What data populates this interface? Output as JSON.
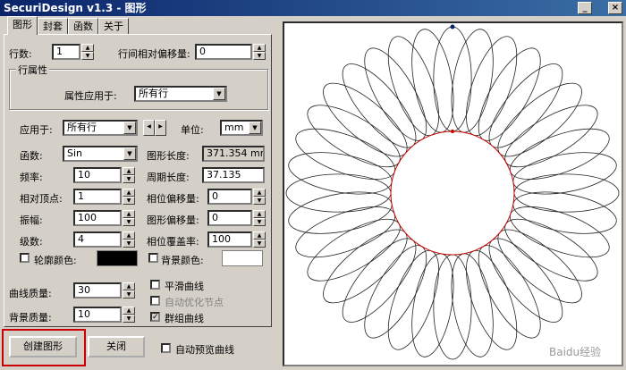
{
  "window": {
    "title": "SecuriDesign v1.3 - 图形",
    "minimize": "_",
    "close": "×"
  },
  "tabs": [
    "图形",
    "封套",
    "函数",
    "关于"
  ],
  "top_row": {
    "rows_label": "行数:",
    "rows_value": "1",
    "row_offset_label": "行间相对偏移量:",
    "row_offset_value": "0"
  },
  "row_props": {
    "group_title": "行属性",
    "apply_attr_label": "属性应用于:",
    "apply_attr_value": "所有行"
  },
  "fields": {
    "apply_label": "应用于:",
    "apply_value": "所有行",
    "unit_label": "单位:",
    "unit_value": "mm",
    "func_label": "函数:",
    "func_value": "Sin",
    "length_label": "图形长度:",
    "length_value": "371.354 mm",
    "freq_label": "频率:",
    "freq_value": "10",
    "period_label": "周期长度:",
    "period_value": "37.135",
    "vertex_label": "相对顶点:",
    "vertex_value": "1",
    "phase_offset_label": "相位偏移量:",
    "phase_offset_value": "0",
    "amp_label": "振幅:",
    "amp_value": "100",
    "shape_offset_label": "图形偏移量:",
    "shape_offset_value": "0",
    "series_label": "级数:",
    "series_value": "4",
    "phase_cover_label": "相位覆盖率:",
    "phase_cover_value": "100",
    "outline_color_label": "轮廓颜色:",
    "bg_color_label": "背景颜色:"
  },
  "quality": {
    "curve_label": "曲线质量:",
    "curve_value": "30",
    "bg_label": "背景质量:",
    "bg_value": "10"
  },
  "options": {
    "smooth": "平滑曲线",
    "auto_opt": "自动优化节点",
    "group": "群组曲线"
  },
  "buttons": {
    "create": "创建图形",
    "close": "关闭",
    "auto_preview": "自动预览曲线"
  },
  "colors": {
    "outline": "#000000",
    "background": "#ffffff",
    "accent": "#cc0000"
  },
  "preview": {
    "petals": 36,
    "watermark": "Baidu经验"
  }
}
